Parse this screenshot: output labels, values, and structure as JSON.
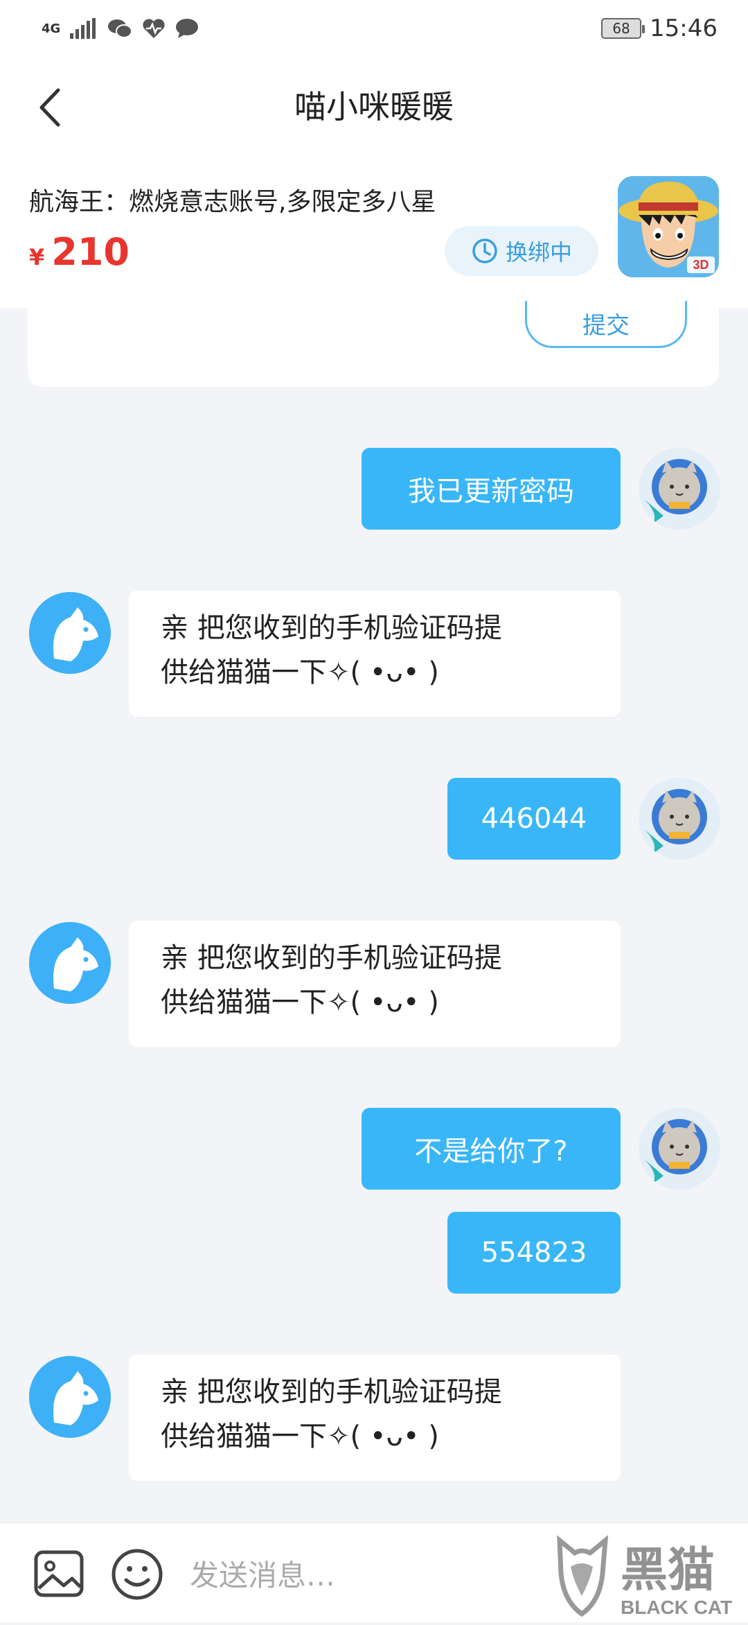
{
  "status_bar": {
    "network": "4G",
    "battery": "68",
    "time": "15:46"
  },
  "header": {
    "title": "喵小咪暖暖"
  },
  "product": {
    "name": "航海王：燃烧意志账号,多限定多八星",
    "currency": "¥",
    "price": "210",
    "status": "换绑中"
  },
  "card": {
    "submit_label": "提交"
  },
  "messages": [
    {
      "from": "me",
      "text": "我已更新密码"
    },
    {
      "from": "bot",
      "lines": [
        "亲 把您收到的手机验证码提",
        "供给猫猫一下✧( •ᴗ• )"
      ]
    },
    {
      "from": "me",
      "text": "446044"
    },
    {
      "from": "bot",
      "lines": [
        "亲 把您收到的手机验证码提",
        "供给猫猫一下✧( •ᴗ• )"
      ]
    },
    {
      "from": "me",
      "text": "不是给你了?"
    },
    {
      "from": "me",
      "text": "554823"
    },
    {
      "from": "bot",
      "lines": [
        "亲 把您收到的手机验证码提",
        "供给猫猫一下✧( •ᴗ• )"
      ]
    }
  ],
  "input": {
    "placeholder": "发送消息…"
  },
  "watermark": {
    "cn": "黑猫",
    "en": "BLACK CAT"
  }
}
